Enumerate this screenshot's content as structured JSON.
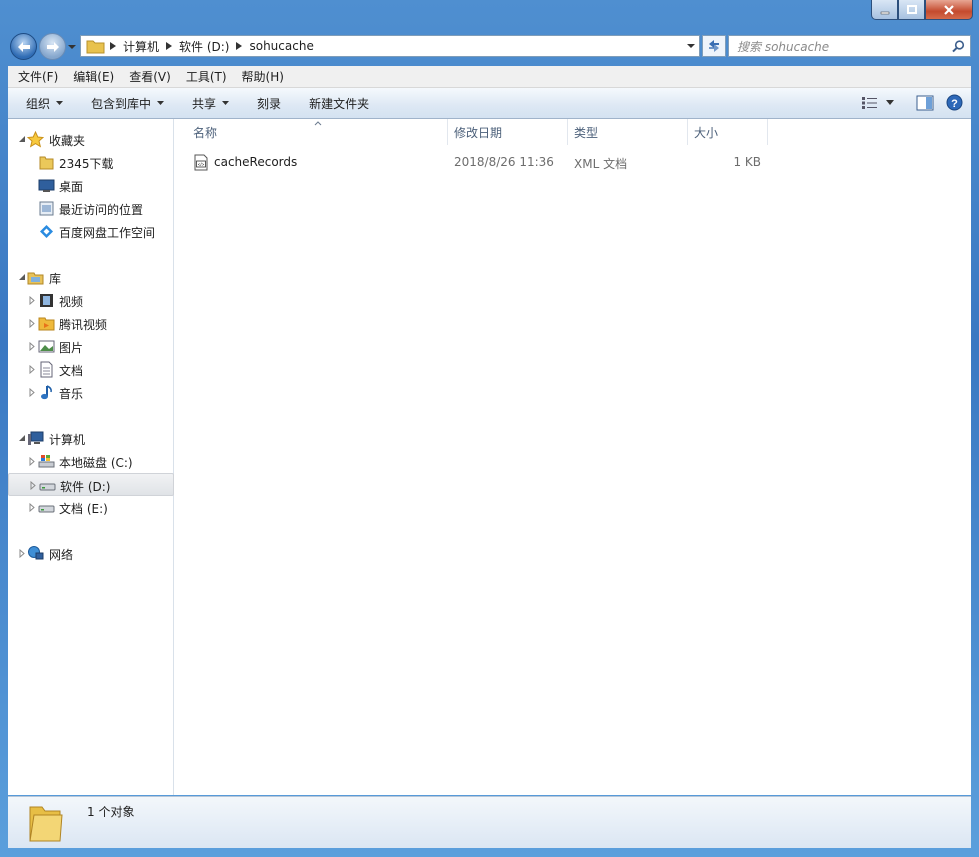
{
  "address": {
    "crumbs": [
      "计算机",
      "软件 (D:)",
      "sohucache"
    ],
    "search_placeholder": "搜索 sohucache"
  },
  "menu": [
    "文件(F)",
    "编辑(E)",
    "查看(V)",
    "工具(T)",
    "帮助(H)"
  ],
  "toolbar": {
    "organize": "组织",
    "include_in_library": "包含到库中",
    "share": "共享",
    "burn": "刻录",
    "new_folder": "新建文件夹"
  },
  "navpane": {
    "favorites": {
      "label": "收藏夹",
      "items": [
        "2345下载",
        "桌面",
        "最近访问的位置",
        "百度网盘工作空间"
      ]
    },
    "libraries": {
      "label": "库",
      "items": [
        "视频",
        "腾讯视频",
        "图片",
        "文档",
        "音乐"
      ]
    },
    "computer": {
      "label": "计算机",
      "items": [
        "本地磁盘 (C:)",
        "软件 (D:)",
        "文档 (E:)"
      ]
    },
    "network": {
      "label": "网络"
    }
  },
  "columns": [
    "名称",
    "修改日期",
    "类型",
    "大小"
  ],
  "files": [
    {
      "name": "cacheRecords",
      "date": "2018/8/26 11:36",
      "type": "XML 文档",
      "size": "1 KB"
    }
  ],
  "status": {
    "text": "1 个对象"
  },
  "colors": {
    "accent": "#3a78c2",
    "selection": "#e0e3e7",
    "header_text": "#4c607a"
  }
}
